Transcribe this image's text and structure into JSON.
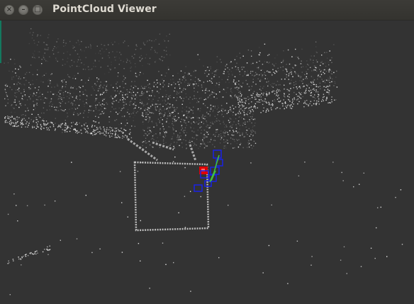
{
  "window": {
    "title": "PointCloud Viewer",
    "buttons": {
      "close_glyph": "×",
      "minimize_glyph": "–",
      "maximize_glyph": "□"
    }
  },
  "scene": {
    "background_color": "#333333",
    "point_color_light": "#d8d8d8",
    "point_color_dark": "#8c8c8c",
    "marker_colors": {
      "red": "#e00000",
      "blue": "#1a22e6",
      "green": "#3fc23f"
    }
  }
}
